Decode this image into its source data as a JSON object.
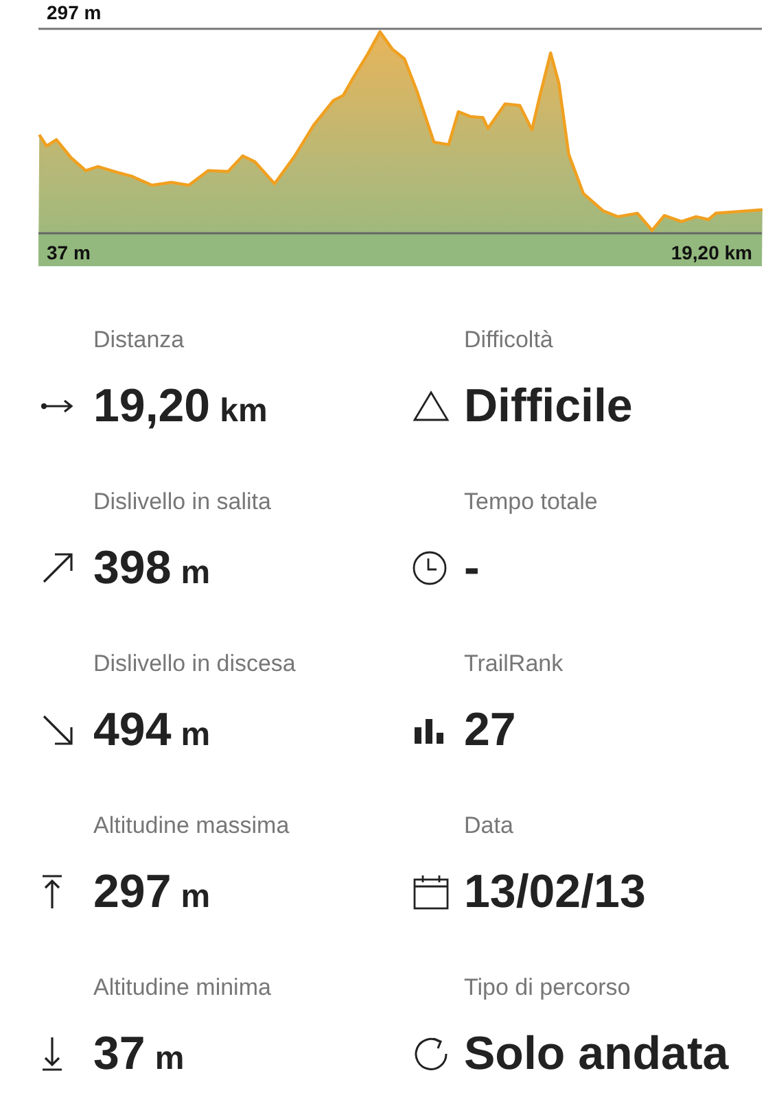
{
  "profile": {
    "max_label": "297 m",
    "min_label": "37 m",
    "distance_label": "19,20 km"
  },
  "stats": [
    {
      "kind": "distance",
      "label": "Distanza",
      "value": "19,20",
      "unit": "km"
    },
    {
      "kind": "difficulty",
      "label": "Difficoltà",
      "value": "Difficile"
    },
    {
      "kind": "ascent",
      "label": "Dislivello in salita",
      "value": "398",
      "unit": "m"
    },
    {
      "kind": "time",
      "label": "Tempo totale",
      "value": "-"
    },
    {
      "kind": "descent",
      "label": "Dislivello in discesa",
      "value": "494",
      "unit": "m"
    },
    {
      "kind": "rank",
      "label": "TrailRank",
      "value": "27"
    },
    {
      "kind": "max",
      "label": "Altitudine massima",
      "value": "297",
      "unit": "m"
    },
    {
      "kind": "date",
      "label": "Data",
      "value": "13/02/13"
    },
    {
      "kind": "min",
      "label": "Altitudine minima",
      "value": "37",
      "unit": "m"
    },
    {
      "kind": "route",
      "label": "Tipo di percorso",
      "value": "Solo andata"
    }
  ]
}
